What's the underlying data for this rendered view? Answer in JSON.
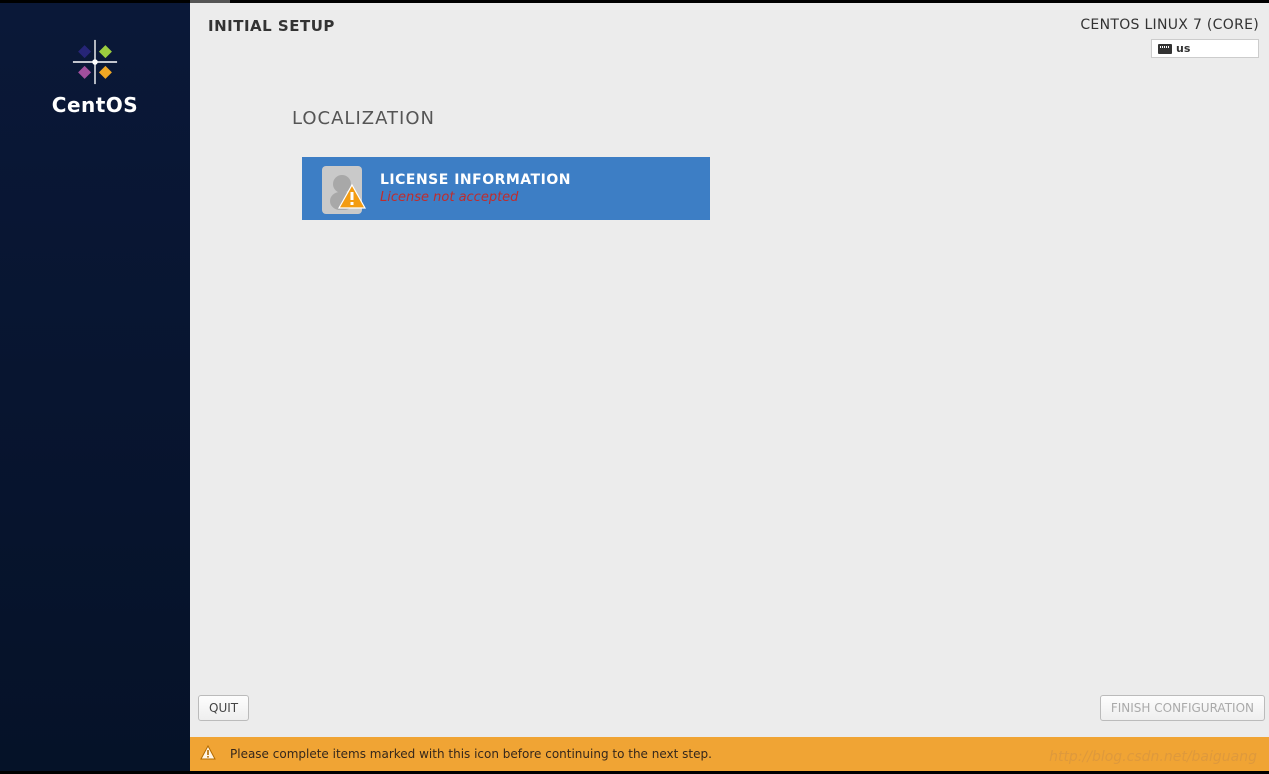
{
  "sidebar": {
    "brand": "CentOS"
  },
  "header": {
    "title": "INITIAL SETUP",
    "distro": "CENTOS LINUX 7 (CORE)",
    "keyboard_layout": "us"
  },
  "section": {
    "title": "LOCALIZATION",
    "spoke": {
      "title": "LICENSE INFORMATION",
      "status": "License not accepted"
    }
  },
  "footer": {
    "quit_label": "QUIT",
    "finish_label": "FINISH CONFIGURATION"
  },
  "warning": {
    "message": "Please complete items marked with this icon before continuing to the next step."
  },
  "watermark": "http://blog.csdn.net/baiguang"
}
